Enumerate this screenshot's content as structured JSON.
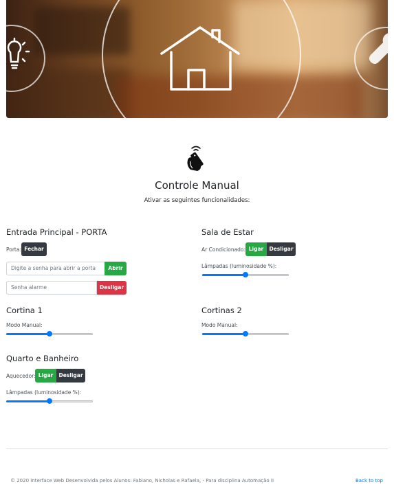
{
  "header": {
    "title": "Controle Manual",
    "subtitle": "Ativar as seguintes funcionalidades:"
  },
  "entrada": {
    "heading": "Entrada Principal - PORTA",
    "porta_label": "Porta:",
    "fechar_label": "Fechar",
    "senha_placeholder": "Digite a senha para abrir a porta",
    "abrir_label": "Abrir",
    "alarme_placeholder": "Senha alarme",
    "desligar_label": "Desligar"
  },
  "sala": {
    "heading": "Sala de Estar",
    "ar_label": "Ar Condicionado:",
    "ligar_label": "Ligar",
    "desligar_label": "Desligar",
    "lampadas_label": "Lâmpadas (luminosidade %):",
    "lampadas_value": 0.5
  },
  "cortina1": {
    "heading": "Cortina 1",
    "modo_label": "Modo Manual:",
    "value": 0.5
  },
  "cortina2": {
    "heading": "Cortinas 2",
    "modo_label": "Modo Manual:",
    "value": 0.5
  },
  "quarto": {
    "heading": "Quarto e Banheiro",
    "aquecedor_label": "Aquecedor:",
    "ligar_label": "Ligar",
    "desligar_label": "Desligar",
    "lampadas_label": "Lâmpadas (luminosidade %):",
    "lampadas_value": 0.5
  },
  "footer": {
    "text": "© 2020 Interface Web Desenvolvida pelos Alunos: Fabiano, Nicholas e Rafaela, - Para disciplina Automação II",
    "back_to_top": "Back to top"
  },
  "icons": {
    "hero": [
      "house-icon",
      "lightbulb-icon",
      "wrench-icon"
    ],
    "logo": "hand-remote-icon"
  },
  "colors": {
    "accent": "#007bff",
    "success": "#28a745",
    "danger": "#dc3545",
    "dark": "#343a40"
  }
}
